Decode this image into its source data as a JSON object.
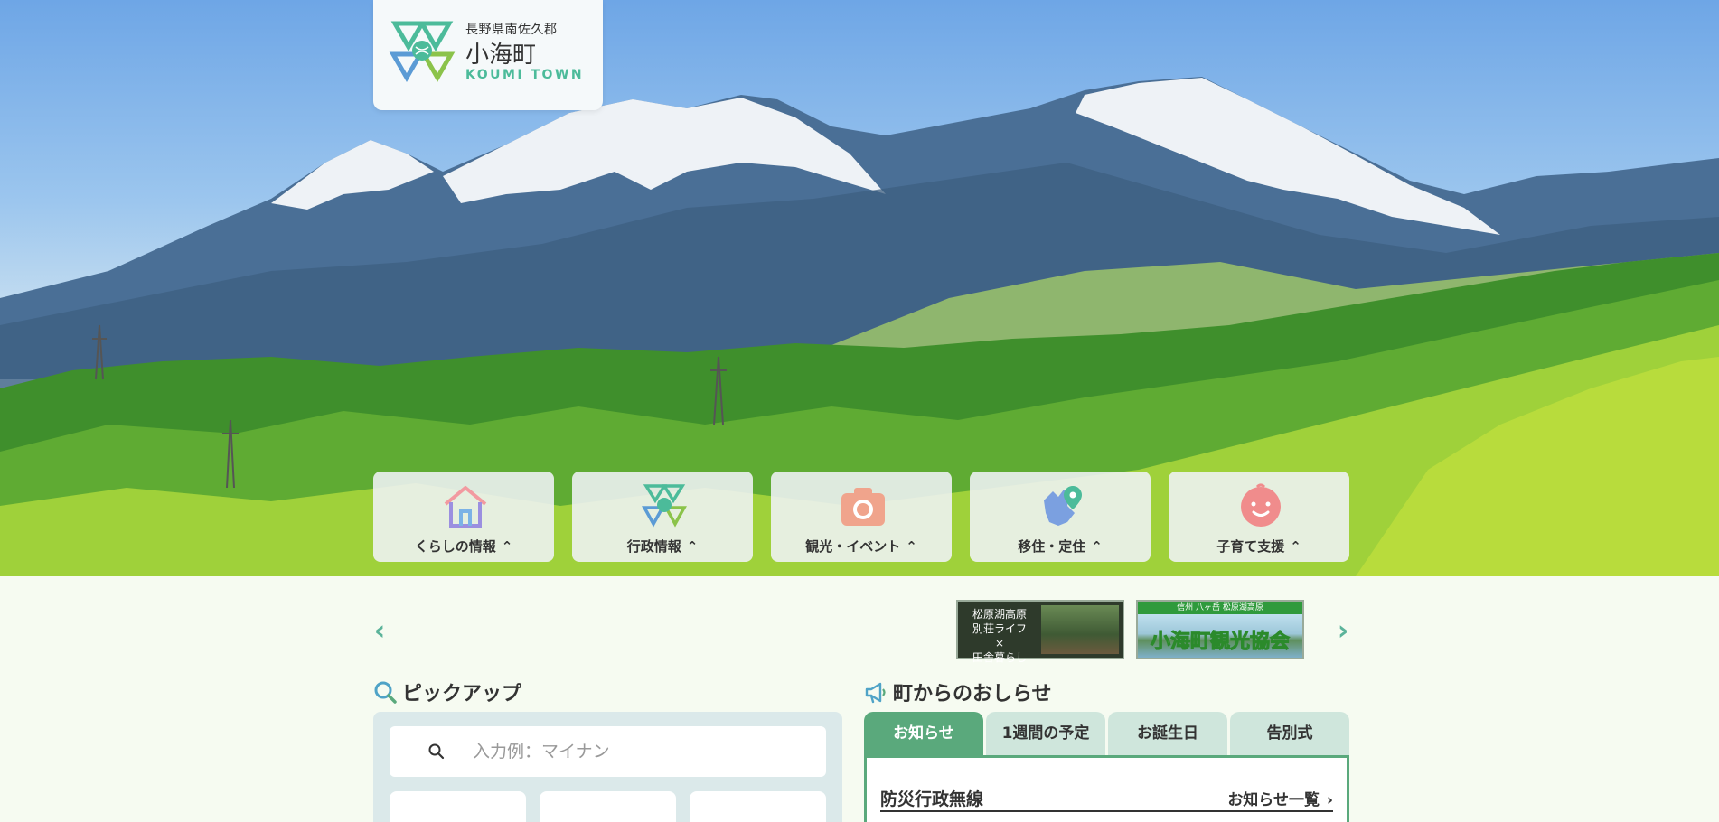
{
  "logo": {
    "prefecture": "長野県南佐久郡",
    "town": "小海町",
    "english": "KOUMI TOWN"
  },
  "categories": [
    {
      "label": "くらしの情報",
      "icon": "house-icon"
    },
    {
      "label": "行政情報",
      "icon": "town-emblem-icon"
    },
    {
      "label": "観光・イベント",
      "icon": "camera-icon"
    },
    {
      "label": "移住・定住",
      "icon": "map-pin-icon"
    },
    {
      "label": "子育て支援",
      "icon": "baby-face-icon"
    }
  ],
  "category_chevron": "^",
  "carousel": {
    "prev": "‹",
    "next": "›",
    "banners": [
      {
        "text": "松原湖高原\n別荘ライフ\n×\n田舎暮らし"
      },
      {
        "top": "信州 八ヶ岳 松原湖高原",
        "title": "小海町観光協会"
      }
    ]
  },
  "pickup": {
    "title": "ピックアップ",
    "search_placeholder": "入力例：マイナン"
  },
  "notices": {
    "title": "町からのおしらせ",
    "tabs": [
      "お知らせ",
      "1週間の予定",
      "お誕生日",
      "告別式"
    ],
    "active_tab": 0,
    "category": "防災行政無線",
    "list_link": "お知らせ一覧"
  },
  "colors": {
    "accent_green": "#5aa97c",
    "tab_inactive": "#cfe6dc",
    "logo_english": "#4cbb9a",
    "pickup_bg": "#dbe9ea",
    "page_bg": "#f6fbf1"
  }
}
